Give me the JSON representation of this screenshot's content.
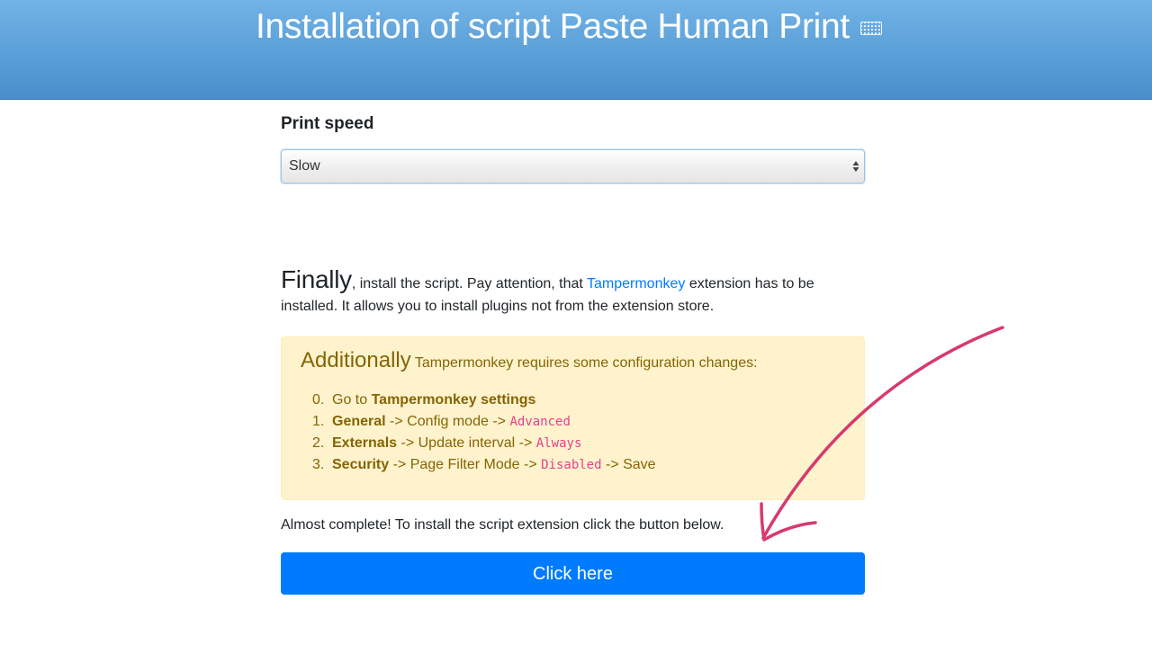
{
  "header": {
    "title": "Installation of script Paste Human Print"
  },
  "speed": {
    "label": "Print speed",
    "selected": "Slow"
  },
  "finally": {
    "big_word": "Finally",
    "text_before_link": ", install the script. Pay attention, that ",
    "link_text": "Tampermonkey",
    "text_after_link": " extension has to be installed. It allows you to install plugins not from the extension store."
  },
  "alert": {
    "heading_big": "Additionally",
    "heading_small": " Tampermonkey requires some configuration changes:",
    "steps": [
      {
        "num": "0.",
        "pre": "Go to ",
        "bold": "Tampermonkey settings",
        "mid": "",
        "code": "",
        "post": ""
      },
      {
        "num": "1.",
        "pre": "",
        "bold": "General",
        "mid": " -> Config mode -> ",
        "code": "Advanced",
        "post": ""
      },
      {
        "num": "2.",
        "pre": "",
        "bold": "Externals",
        "mid": " -> Update interval -> ",
        "code": "Always",
        "post": ""
      },
      {
        "num": "3.",
        "pre": "",
        "bold": "Security",
        "mid": " -> Page Filter Mode -> ",
        "code": "Disabled",
        "post": " -> Save"
      }
    ]
  },
  "almost_text": "Almost complete! To install the script extension click the button below.",
  "button_label": "Click here",
  "colors": {
    "header_blue": "#5a9fd8",
    "link_blue": "#007bff",
    "button_blue": "#007bff",
    "alert_bg": "#fff3cd",
    "alert_text": "#856404",
    "code_pink": "#e83e8c",
    "arrow_pink": "#d63a6e"
  },
  "icons": {
    "header_icon": "keyboard-icon",
    "select_icon": "select-arrows-icon",
    "annotation": "hand-drawn-arrow-icon"
  }
}
